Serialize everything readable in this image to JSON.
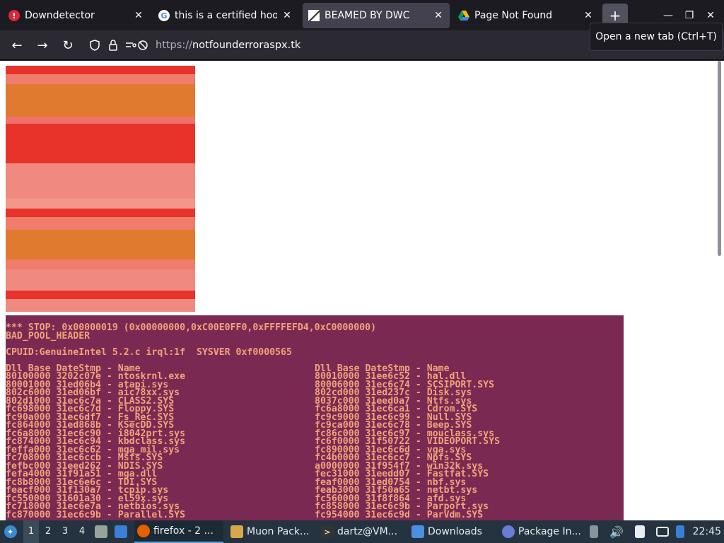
{
  "tabs": [
    {
      "title": "Downdetector",
      "favicon": "downdetector-icon",
      "active": false
    },
    {
      "title": "this is a certified hood",
      "favicon": "google-icon",
      "active": false
    },
    {
      "title": "BEAMED BY DWC",
      "favicon": "page-icon",
      "active": true
    },
    {
      "title": "Page Not Found",
      "favicon": "drive-icon",
      "active": false
    }
  ],
  "new_tab_label": "+",
  "tooltip": "Open a new tab (Ctrl+T)",
  "url": {
    "scheme": "https://",
    "host": "notfounderroraspx.tk"
  },
  "bsod": {
    "header": [
      "*** STOP: 0x00000019 (0x00000000,0xC00E0FF0,0xFFFFEFD4,0xC0000000)",
      "BAD_POOL_HEADER"
    ],
    "cpuid": "CPUID:GenuineIntel 5.2.c irql:1f  SYSVER 0xf0000565",
    "left": [
      "Dll Base DateStmp - Name",
      "80100000 3202c07e - ntoskrnl.exe",
      "80001000 31ed06b4 - atapi.sys",
      "802c6000 31ed06bf - aic78xx.sys",
      "802d1000 31ec6c7a - CLASS2.SYS",
      "fc698000 31ec6c7d - Floppy.SYS",
      "fc90a000 31ec6df7 - Fs_Rec.SYS",
      "fc864000 31ed868b - KSecDD.SYS",
      "fc6a8000 31ec6c90 - i8042prt.sys",
      "fc874000 31ec6c94 - kbdclass.sys",
      "feffa000 31ec6c62 - mga_mil.sys",
      "fc708000 31ec6ccb - Msfs.SYS",
      "fefbc000 31eed262 - NDIS.SYS",
      "fefa4000 31f91a51 - mga.dll",
      "fc8b8000 31ec6e6c - TDI.SYS",
      "feacf000 31f130a7 - tcpip.sys",
      "fc550000 31601a30 - el59x.sys",
      "fc718000 31ec6e7a - netbios.sys",
      "fc870000 31ec6c9b - Parallel.SYS"
    ],
    "right": [
      "Dll Base DateStmp - Name",
      "80010000 31ee6c52 - hal.dll",
      "80006000 31ec6c74 - SCSIPORT.SYS",
      "802cd000 31ed237c - Disk.sys",
      "8037c000 31eed0a7 - Ntfs.sys",
      "fc6a8000 31ec6ca1 - Cdrom.SYS",
      "fc9c9000 31ec6c99 - Null.SYS",
      "fc9ca000 31ec6c78 - Beep.SYS",
      "fc86c000 31ec6c97 - mouclass.sys",
      "fc6f0000 31f50722 - VIDEOPORT.SYS",
      "fc890000 31ec6c6d - vga.sys",
      "fc4b0000 31ec6cc7 - Npfs.SYS",
      "a0000000 31f954f7 - win32k.sys",
      "fec31000 31eedd07 - Fastfat.SYS",
      "feaf0000 31ed0754 - nbf.sys",
      "feab3000 31f50a65 - netbt.sys",
      "fc560000 31f8f864 - afd.sys",
      "fc858000 31ec6c9b - Parport.sys",
      "fc954000 31ec6c9d - ParVdm.SYS"
    ]
  },
  "taskbar": {
    "workspaces": [
      "1",
      "2",
      "3",
      "4"
    ],
    "items": [
      {
        "label": "firefox - 2 ...",
        "icon": "firefox-icon"
      },
      {
        "label": "Muon Pack...",
        "icon": "muon-icon"
      },
      {
        "label": "dartz@VM...",
        "icon": "terminal-icon"
      },
      {
        "label": "Downloads",
        "icon": "folder-icon"
      },
      {
        "label": "Package In...",
        "icon": "package-icon"
      }
    ],
    "clock": "22:45"
  },
  "colors": {
    "bsod_bg": "#7a2a52",
    "bsod_text": "#f3a27a",
    "tab_active": "#42414d"
  }
}
